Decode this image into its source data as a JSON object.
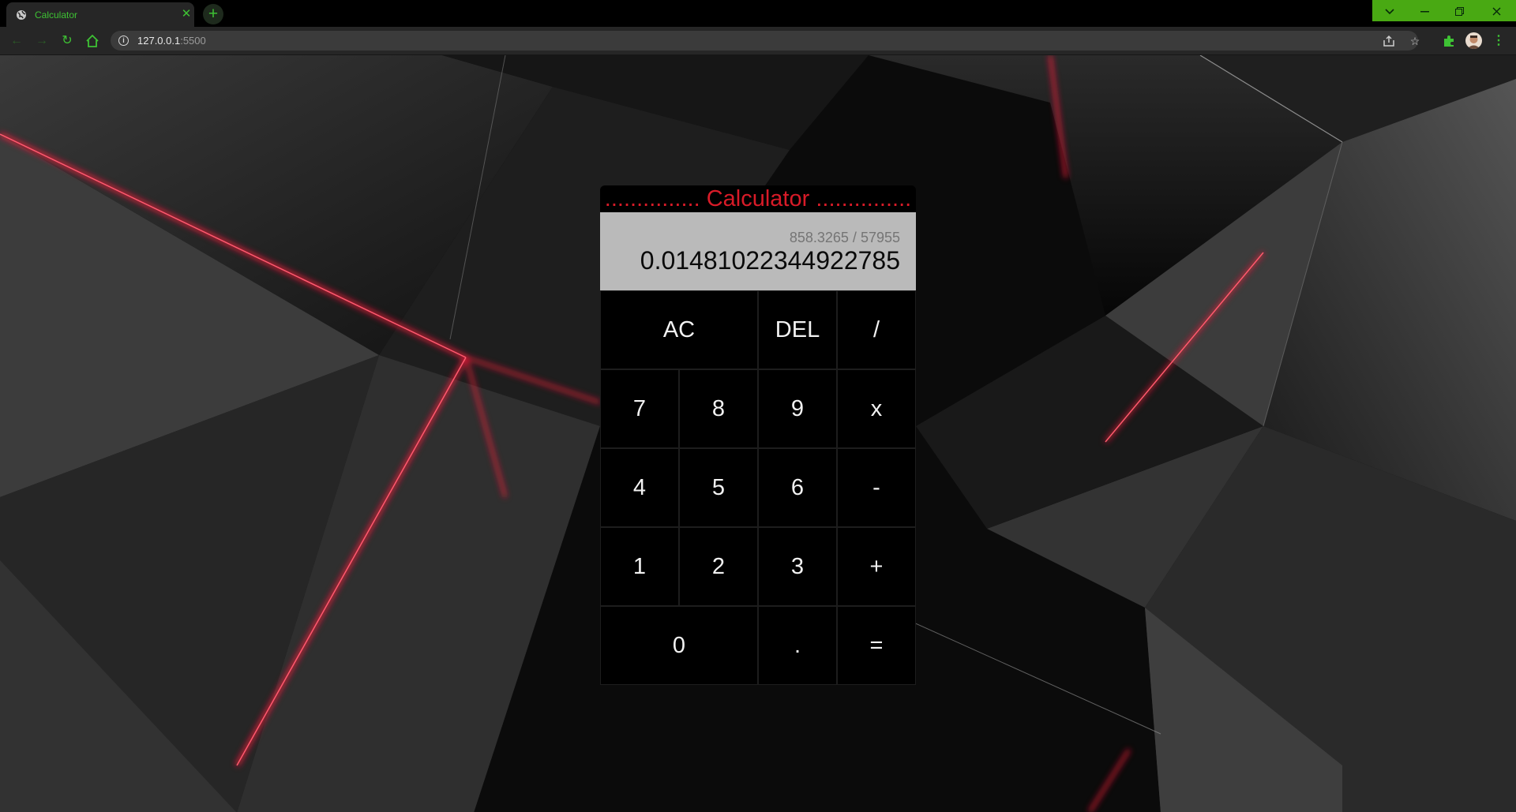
{
  "browser": {
    "tab_title": "Calculator",
    "url_host": "127.0.0.1",
    "url_port": ":5500",
    "accent_color": "#3ec234",
    "window_controls_color": "#49a913",
    "icons": [
      "globe-icon",
      "close-icon",
      "plus-icon",
      "back-icon",
      "forward-icon",
      "reload-icon",
      "home-icon",
      "info-icon",
      "share-icon",
      "star-icon",
      "extensions-icon",
      "avatar",
      "menu-icon",
      "tab-search-icon",
      "minimize-icon",
      "restore-icon",
      "window-close-icon"
    ]
  },
  "calculator": {
    "title": "Calculator",
    "title_color": "#d81b28",
    "previous_operand": "858.3265 / 57955",
    "current_operand": "0.01481022344922785",
    "display_color": "#bababa",
    "keys": {
      "ac": "AC",
      "del": "DEL",
      "divide": "/",
      "seven": "7",
      "eight": "8",
      "nine": "9",
      "multiply": "x",
      "four": "4",
      "five": "5",
      "six": "6",
      "subtract": "-",
      "one": "1",
      "two": "2",
      "three": "3",
      "add": "+",
      "zero": "0",
      "decimal": ".",
      "equals": "="
    }
  }
}
